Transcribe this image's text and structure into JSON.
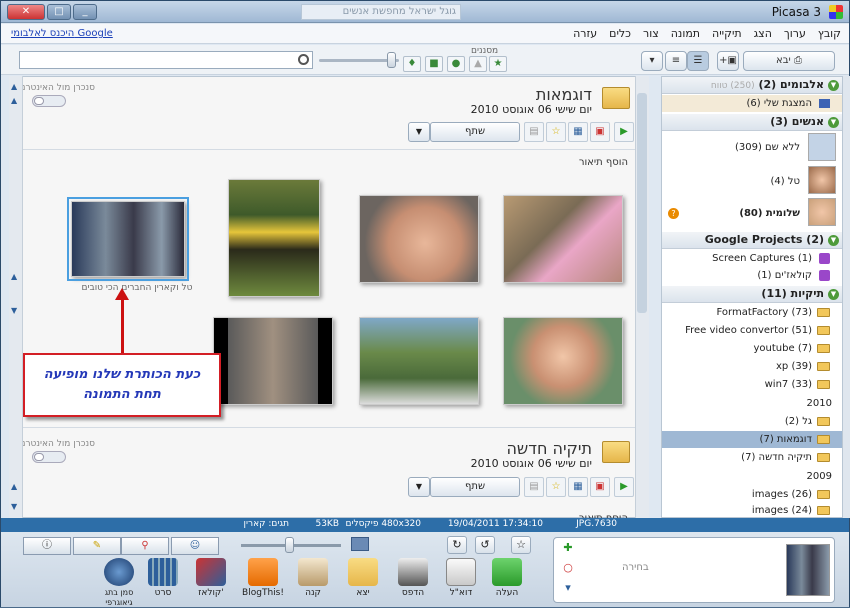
{
  "window": {
    "title": "Picasa 3",
    "address": "גוגל ישראל מחפשת אנשים"
  },
  "menu": {
    "items": [
      "קובץ",
      "ערוך",
      "הצג",
      "תיקייה",
      "תמונה",
      "צור",
      "כלים",
      "עזרה"
    ],
    "google_link": "היכנס לאלבומי Google"
  },
  "toolbar": {
    "import": "יבא",
    "filters_label": "מסננים"
  },
  "album1": {
    "title": "דוגמאות",
    "date": "יום שישי 06 אוגוסט 2010",
    "sync_label": "סנכרן מול האינטרנט",
    "share": "שתף",
    "add_description": "הוסף תיאור",
    "caption": "טל וקארין החברים הכי טובים"
  },
  "album2": {
    "title": "תיקיה חדשה",
    "date": "יום שישי 06 אוגוסט 2010",
    "sync_label": "סנכרן מול האינטרנט",
    "share": "שתף",
    "add_description": "הוסף תיאור"
  },
  "annotation": {
    "line1": "כעת הכותרת שלנו מופיעה",
    "line2": "תחת התמונה"
  },
  "sidebar": {
    "albums": "אלבומים (2)",
    "albums_hint": "(250) טווח",
    "album_item": "המצגת שלי (6)",
    "people": "אנשים (3)",
    "people_items": [
      "ללא שם (309)",
      "טל (4)",
      "שלומית (80)"
    ],
    "projects": "Google Projects (2)",
    "project_items": [
      "Screen Captures (1)",
      "קולאז'ים (1)"
    ],
    "folders": "תיקיות (11)",
    "folder_items": [
      "FormatFactory (73)",
      "Free video convertor (51)",
      "youtube (7)",
      "xp (39)",
      "win7 (33)"
    ],
    "year_2010": "2010",
    "items_2010": [
      "גל (2)",
      "דוגמאות (7)",
      "תיקיה חדשה (7)"
    ],
    "year_2009": "2009",
    "items_2009": [
      "images (26)",
      "images (24)"
    ]
  },
  "status": {
    "file": "7630.JPG",
    "datetime": "17:34:10 19/04/2011",
    "pixels": "480x320 פיקסלים",
    "size": "53KB",
    "tags": "תגים: קארין"
  },
  "bottom": {
    "tray_label": "בחירה",
    "actions": [
      "העלה",
      "דוא\"ל",
      "הדפס",
      "יצא",
      "קנה",
      "BlogThis!",
      "קולאז'",
      "סרט",
      "סמן בתג גיאוגרפי"
    ]
  }
}
